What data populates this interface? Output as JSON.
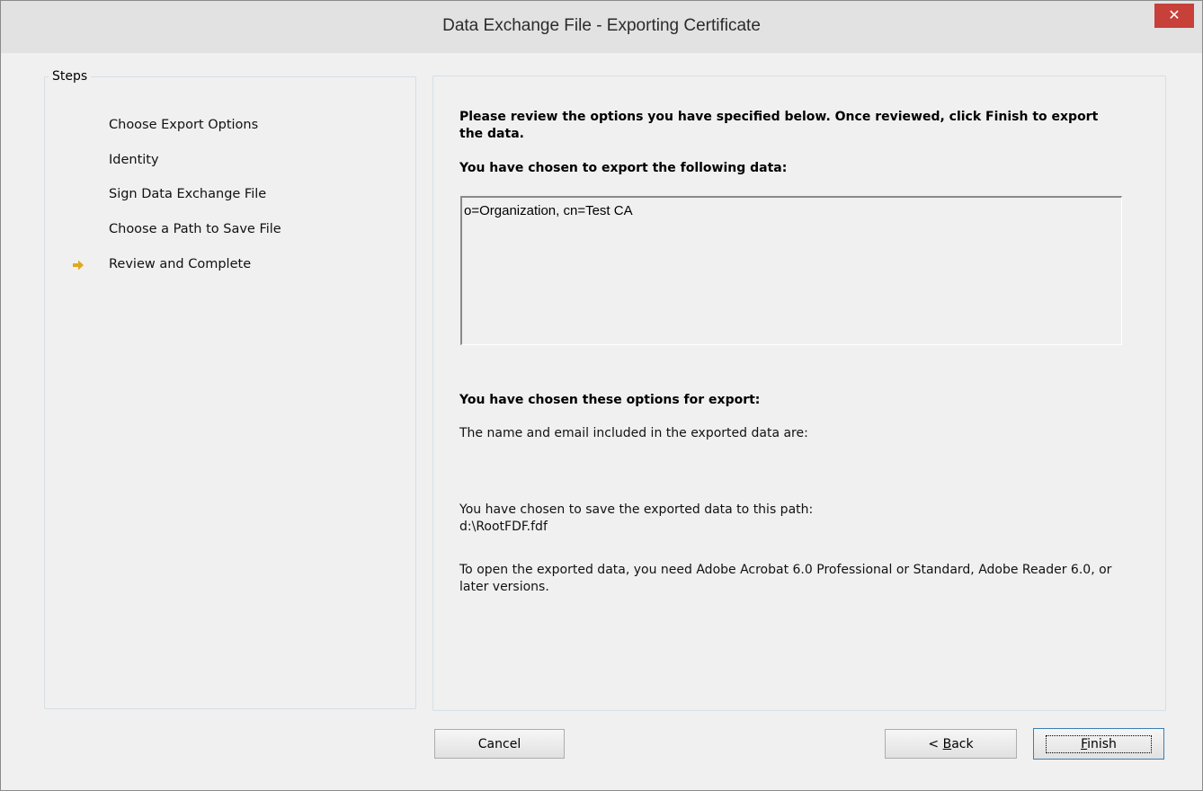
{
  "window": {
    "title": "Data Exchange File - Exporting Certificate",
    "close_glyph": "✕"
  },
  "steps": {
    "legend": "Steps",
    "items": [
      {
        "label": "Choose Export Options",
        "current": false
      },
      {
        "label": "Identity",
        "current": false
      },
      {
        "label": "Sign Data Exchange File",
        "current": false
      },
      {
        "label": "Choose a Path to Save File",
        "current": false
      },
      {
        "label": "Review and Complete",
        "current": true
      }
    ],
    "current_icon": "arrow-right-icon",
    "accent_color": "#e0a81c"
  },
  "content": {
    "review_heading": "Please review the options you have specified below. Once reviewed, click Finish to export the data.",
    "data_heading": "You have chosen to export the following data:",
    "data_entries": [
      "o=Organization, cn=Test CA"
    ],
    "options_heading": "You have chosen these options for export:",
    "name_email_text": "The name and email included in the exported data are:",
    "path_label": "You have chosen to save the exported data to this path:",
    "path_value": "d:\\RootFDF.fdf",
    "requirements_text": "To open the exported data, you need Adobe Acrobat 6.0 Professional or Standard, Adobe Reader 6.0, or later versions."
  },
  "buttons": {
    "cancel": "Cancel",
    "back_prefix": "< ",
    "back_mnemonic": "B",
    "back_rest": "ack",
    "finish_mnemonic": "F",
    "finish_rest": "inish"
  }
}
